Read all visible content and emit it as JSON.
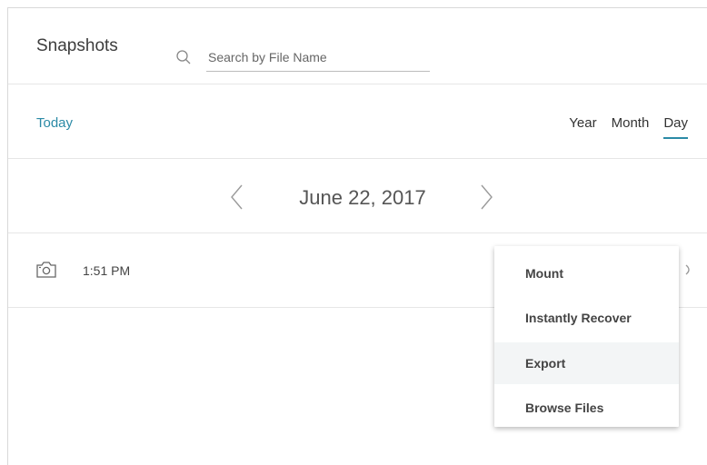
{
  "header": {
    "title": "Snapshots",
    "search_placeholder": "Search by File Name",
    "search_value": ""
  },
  "toolbar": {
    "today_label": "Today",
    "views": [
      "Year",
      "Month",
      "Day"
    ],
    "active_view": "Day"
  },
  "date_nav": {
    "date": "June 22, 2017"
  },
  "snapshots": [
    {
      "time": "1:51 PM"
    }
  ],
  "context_menu": {
    "items": [
      "Mount",
      "Instantly Recover",
      "Export",
      "Browse Files"
    ],
    "hovered": "Export"
  },
  "colors": {
    "accent": "#2b8aa6",
    "divider": "#e6e6e6",
    "menu_hover": "#f3f5f6"
  },
  "icons": {
    "search": "search-icon",
    "prev": "chevron-left-icon",
    "next": "chevron-right-icon",
    "snapshot": "camera-icon"
  }
}
